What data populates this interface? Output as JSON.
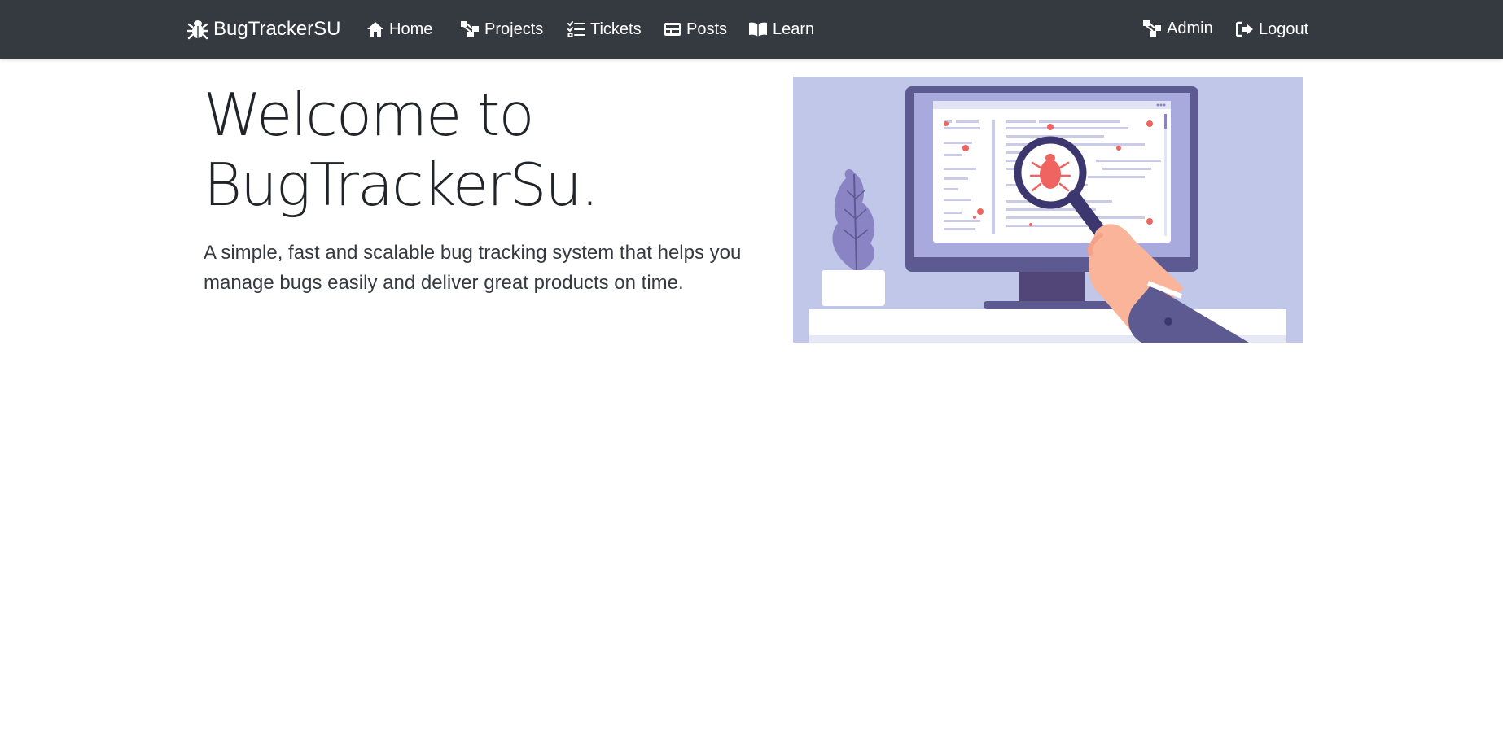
{
  "navbar": {
    "brand": "BugTrackerSU",
    "links": [
      {
        "label": "Home",
        "icon": "home-icon"
      },
      {
        "label": "Projects",
        "icon": "sitemap-icon"
      },
      {
        "label": "Tickets",
        "icon": "tasks-icon"
      },
      {
        "label": "Posts",
        "icon": "card-icon"
      },
      {
        "label": "Learn",
        "icon": "book-icon"
      }
    ],
    "right_links": [
      {
        "label": "Admin",
        "icon": "sitemap-icon"
      },
      {
        "label": "Logout",
        "icon": "sign-out-icon"
      }
    ],
    "colors": {
      "background": "#343a40",
      "text": "#ffffff"
    }
  },
  "hero": {
    "title": "Welcome to BugTrackerSu.",
    "lead": "A simple, fast and scalable bug tracking system that helps you manage bugs easily and deliver great products on time.",
    "illustration": {
      "icon": "bug-inspection-illustration",
      "colors": {
        "background": "#c5cae9",
        "bug": "#ef6461",
        "monitor": "#5d5a91"
      }
    }
  }
}
